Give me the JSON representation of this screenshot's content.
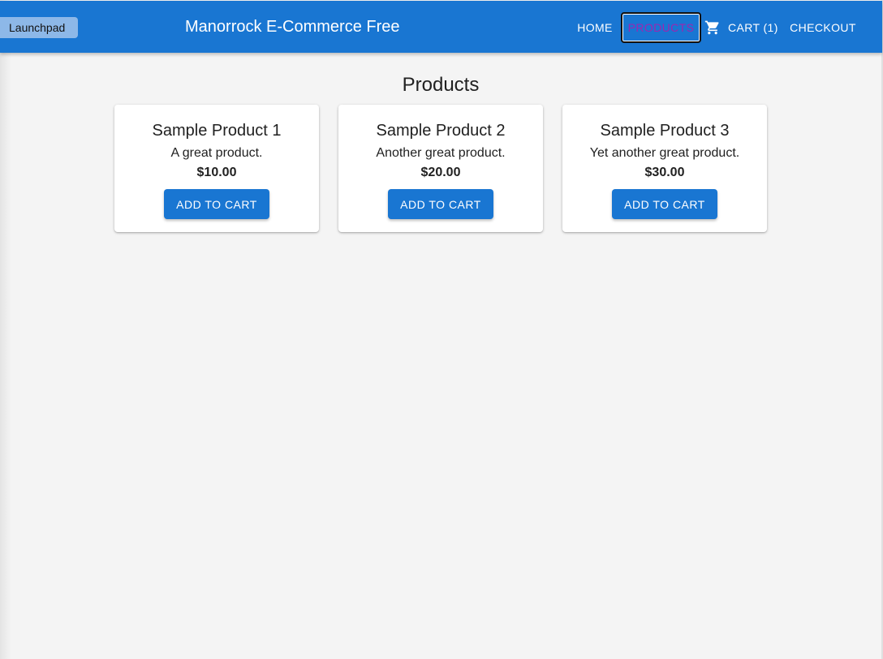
{
  "header": {
    "launchpad_label": "Launchpad",
    "title": "Manorrock E-Commerce Free",
    "nav": {
      "home": "HOME",
      "products": "PRODUCTS",
      "cart": "CART (1)",
      "checkout": "CHECKOUT"
    },
    "cart_icon": "shopping-cart-icon"
  },
  "main": {
    "title": "Products",
    "products": [
      {
        "name": "Sample Product 1",
        "description": "A great product.",
        "price": "$10.00",
        "button": "ADD TO CART"
      },
      {
        "name": "Sample Product 2",
        "description": "Another great product.",
        "price": "$20.00",
        "button": "ADD TO CART"
      },
      {
        "name": "Sample Product 3",
        "description": "Yet another great product.",
        "price": "$30.00",
        "button": "ADD TO CART"
      }
    ]
  },
  "colors": {
    "primary": "#1976d2",
    "active_nav_text": "#9c27b0",
    "background": "#f4f4f4"
  }
}
